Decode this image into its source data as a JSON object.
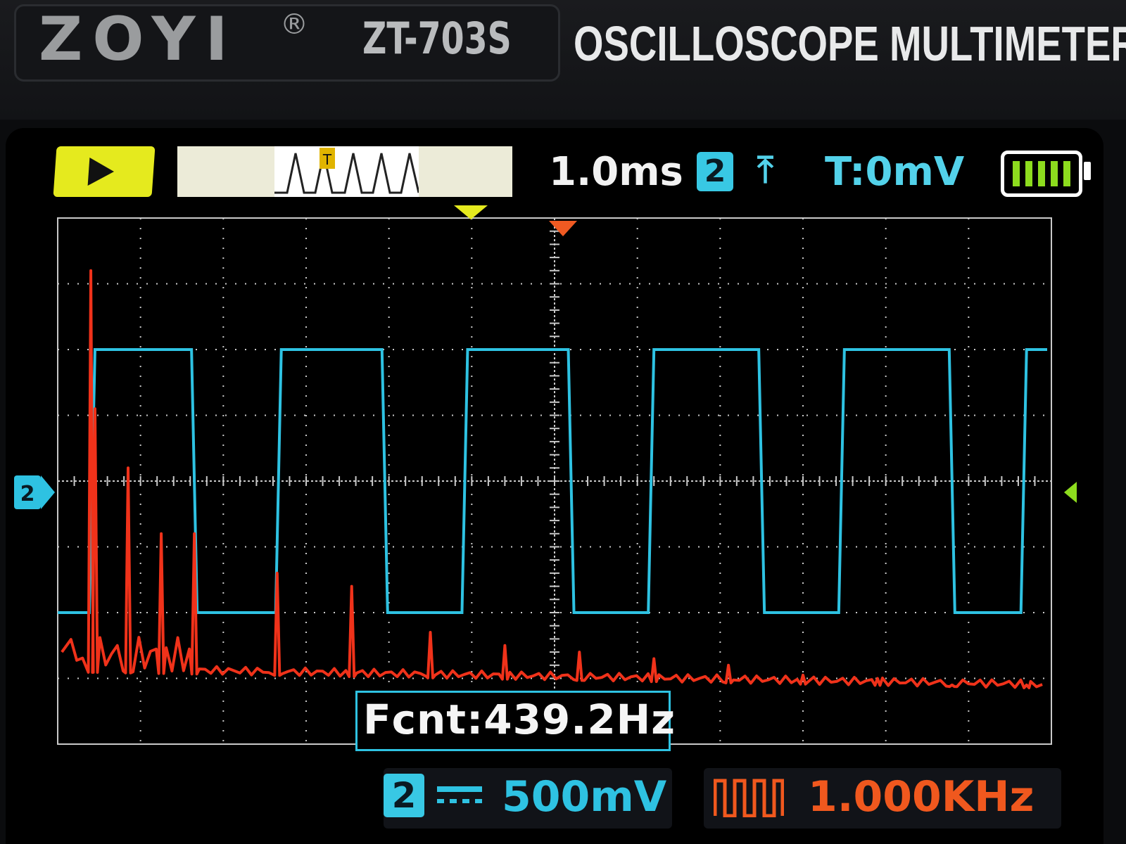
{
  "brand": {
    "name": "ZOYI",
    "registered": "®",
    "model": "ZT-703S",
    "tagline": "OSCILLOSCOPE MULTIMETER"
  },
  "status_bar": {
    "run_state": "play-icon",
    "timebase": "1.0ms",
    "trigger_channel": "2",
    "trigger_edge": "rising-edge-icon",
    "trigger_level": "T:0mV",
    "battery": {
      "icon": "battery-icon",
      "bars_filled": 5,
      "bars_total": 5
    }
  },
  "measurement": {
    "label": "Fcnt:439.2Hz"
  },
  "channel_settings": {
    "channel": "2",
    "coupling": "dc-coupling-icon",
    "volts_per_div": "500mV"
  },
  "generator": {
    "icon": "square-wave-icon",
    "frequency": "1.000KHz"
  },
  "colors": {
    "ch2": "#2ec2e2",
    "math": "#f0321a",
    "accent_yellow": "#e5ea1e",
    "grid": "#c9c9c9"
  },
  "chart_data": {
    "type": "line",
    "series": [
      {
        "name": "CH2",
        "values_description": "square wave",
        "x_high_to_low": [
          0.35,
          2.85,
          5.2,
          7.5,
          9.85
        ],
        "x_low_to_high": [
          1.55,
          3.95,
          6.25,
          8.65,
          10.95
        ],
        "high_div": 2.0,
        "low_div": -2.0
      },
      {
        "name": "FFT",
        "peaks_div": [
          [
            0.4,
            3.2
          ],
          [
            0.45,
            1.1
          ],
          [
            0.85,
            0.2
          ],
          [
            1.25,
            -0.8
          ],
          [
            1.65,
            -0.8
          ],
          [
            2.65,
            -1.4
          ],
          [
            3.55,
            -1.6
          ],
          [
            4.5,
            -2.3
          ],
          [
            5.4,
            -2.5
          ],
          [
            6.3,
            -2.6
          ],
          [
            7.2,
            -2.7
          ],
          [
            8.1,
            -2.8
          ],
          [
            9.0,
            -2.95
          ],
          [
            9.9,
            -3.0
          ],
          [
            10.8,
            -3.1
          ],
          [
            11.7,
            -3.1
          ]
        ]
      }
    ],
    "grid": {
      "x_divisions": 12,
      "y_divisions": 8
    }
  }
}
